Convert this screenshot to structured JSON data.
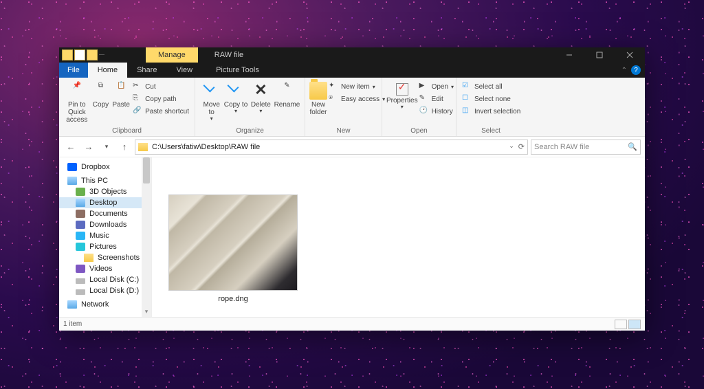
{
  "titlebar": {
    "context_tab": "Manage",
    "window_title": "RAW file"
  },
  "tabs": {
    "file": "File",
    "home": "Home",
    "share": "Share",
    "view": "View",
    "picture_tools": "Picture Tools"
  },
  "ribbon": {
    "clipboard": {
      "label": "Clipboard",
      "pin": "Pin to Quick access",
      "copy": "Copy",
      "paste": "Paste",
      "cut": "Cut",
      "copy_path": "Copy path",
      "paste_shortcut": "Paste shortcut"
    },
    "organize": {
      "label": "Organize",
      "move_to": "Move to",
      "copy_to": "Copy to",
      "delete": "Delete",
      "rename": "Rename"
    },
    "new": {
      "label": "New",
      "new_folder": "New folder",
      "new_item": "New item",
      "easy_access": "Easy access"
    },
    "open": {
      "label": "Open",
      "properties": "Properties",
      "open": "Open",
      "edit": "Edit",
      "history": "History"
    },
    "select": {
      "label": "Select",
      "select_all": "Select all",
      "select_none": "Select none",
      "invert": "Invert selection"
    }
  },
  "address": {
    "path": "C:\\Users\\fatiw\\Desktop\\RAW file"
  },
  "search": {
    "placeholder": "Search RAW file"
  },
  "tree": {
    "dropbox": "Dropbox",
    "this_pc": "This PC",
    "items": {
      "objects3d": "3D Objects",
      "desktop": "Desktop",
      "documents": "Documents",
      "downloads": "Downloads",
      "music": "Music",
      "pictures": "Pictures",
      "screenshots": "Screenshots",
      "videos": "Videos",
      "disk_c": "Local Disk (C:)",
      "disk_d": "Local Disk (D:)",
      "network": "Network"
    }
  },
  "content": {
    "file_name": "rope.dng"
  },
  "status": {
    "count": "1 item"
  }
}
